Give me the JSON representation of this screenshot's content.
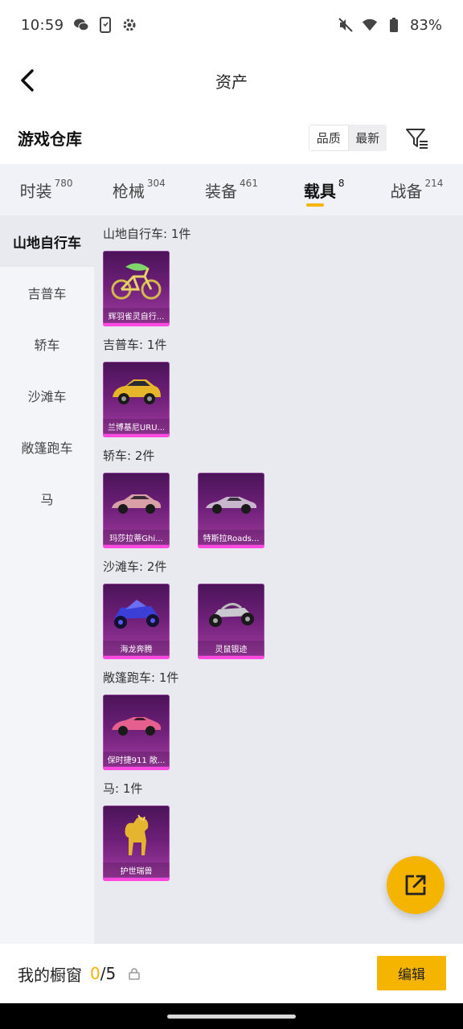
{
  "status_bar": {
    "time": "10:59",
    "battery": "83%"
  },
  "header": {
    "title": "资产"
  },
  "storage": {
    "title": "游戏仓库",
    "sort_options": [
      "品质",
      "最新"
    ]
  },
  "tabs": [
    {
      "label": "时装",
      "count": "780"
    },
    {
      "label": "枪械",
      "count": "304"
    },
    {
      "label": "装备",
      "count": "461"
    },
    {
      "label": "载具",
      "count": "8",
      "active": true
    },
    {
      "label": "战备",
      "count": "214"
    }
  ],
  "sidebar": [
    "山地自行车",
    "吉普车",
    "轿车",
    "沙滩车",
    "敞篷跑车",
    "马"
  ],
  "sections": [
    {
      "title": "山地自行车: 1件",
      "items": [
        {
          "name": "辉羽雀灵自行...",
          "icon": "bike-icon"
        }
      ]
    },
    {
      "title": "吉普车: 1件",
      "items": [
        {
          "name": "兰博基尼URU...",
          "icon": "suv-icon"
        }
      ]
    },
    {
      "title": "轿车: 2件",
      "items": [
        {
          "name": "玛莎拉蒂Ghi...",
          "icon": "sedan-icon"
        },
        {
          "name": "特斯拉Roads...",
          "icon": "roadster-icon"
        }
      ]
    },
    {
      "title": "沙滩车: 2件",
      "items": [
        {
          "name": "海龙奔腾",
          "icon": "buggy-icon"
        },
        {
          "name": "灵鼠银迹",
          "icon": "buggy-icon"
        }
      ]
    },
    {
      "title": "敞篷跑车: 1件",
      "items": [
        {
          "name": "保时捷911 敞...",
          "icon": "convertible-icon"
        }
      ]
    },
    {
      "title": "马: 1件",
      "items": [
        {
          "name": "护世瑞兽",
          "icon": "horse-icon"
        }
      ]
    }
  ],
  "bottom": {
    "label": "我的橱窗",
    "current": "0",
    "total": "/5",
    "edit_label": "编辑"
  },
  "colors": {
    "accent": "#f5b400",
    "card_top": "#4a1458",
    "card_bottom": "#a43ca5",
    "card_bar": "#ff49e1"
  }
}
